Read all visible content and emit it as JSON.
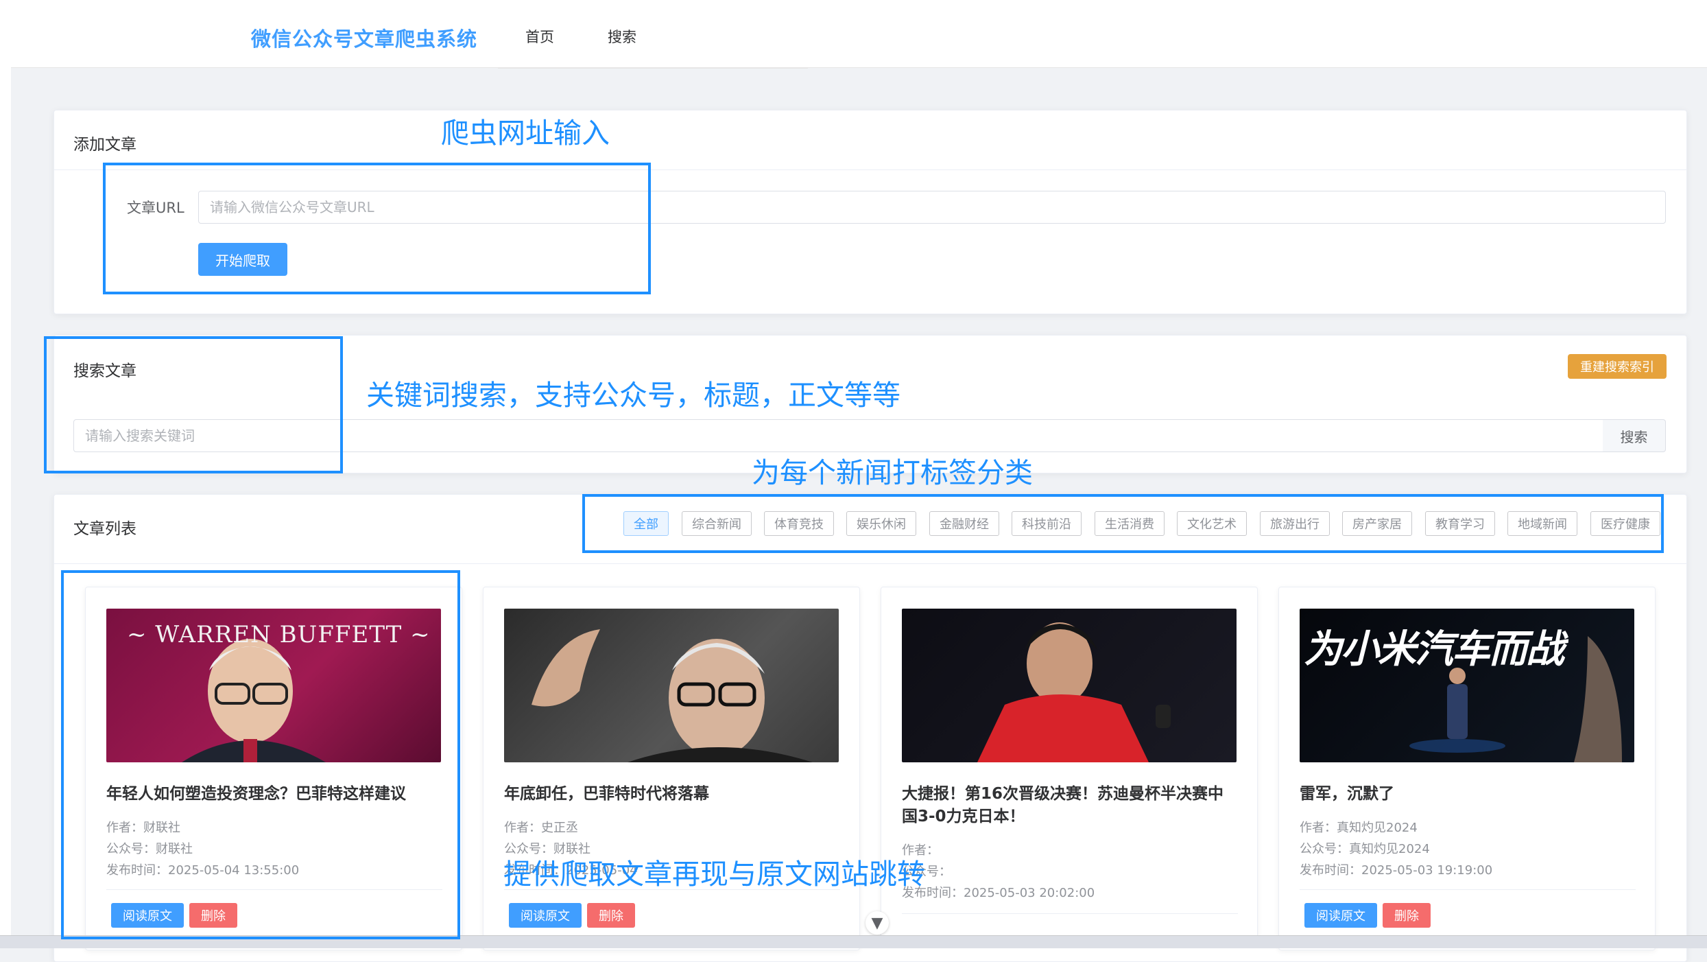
{
  "app": {
    "title": "微信公众号文章爬虫系统",
    "nav": [
      {
        "label": "首页"
      },
      {
        "label": "搜索"
      }
    ]
  },
  "add_card": {
    "title": "添加文章",
    "url_label": "文章URL",
    "url_placeholder": "请输入微信公众号文章URL",
    "submit_label": "开始爬取"
  },
  "search_card": {
    "title": "搜索文章",
    "rebuild_label": "重建搜索索引",
    "placeholder": "请输入搜索关键词",
    "search_label": "搜索"
  },
  "list_card": {
    "title": "文章列表",
    "categories": [
      "全部",
      "综合新闻",
      "体育竞技",
      "娱乐休闲",
      "金融财经",
      "科技前沿",
      "生活消费",
      "文化艺术",
      "旅游出行",
      "房产家居",
      "教育学习",
      "地域新闻",
      "医疗健康"
    ],
    "active_category": "全部"
  },
  "articles": [
    {
      "title": "年轻人如何塑造投资理念？巴菲特这样建议",
      "author": "作者：财联社",
      "account": "公众号：财联社",
      "time": "发布时间：2025-05-04 13:55:00",
      "read_label": "阅读原文",
      "delete_label": "删除",
      "image_text": "~ WARREN BUFFETT ~"
    },
    {
      "title": "年底卸任，巴菲特时代将落幕",
      "author": "作者：史正丞",
      "account": "公众号：财联社",
      "time": "发布时间：2025-05-04",
      "read_label": "阅读原文",
      "delete_label": "删除"
    },
    {
      "title": "大捷报！第16次晋级决赛！苏迪曼杯半决赛中国3-0力克日本！",
      "author": "作者：",
      "account": "公众号：",
      "time": "发布时间：2025-05-03 20:02:00",
      "read_label": "阅读原文",
      "delete_label": "删除"
    },
    {
      "title": "雷军，沉默了",
      "author": "作者：真知灼见2024",
      "account": "公众号：真知灼见2024",
      "time": "发布时间：2025-05-03 19:19:00",
      "read_label": "阅读原文",
      "delete_label": "删除",
      "image_text": "为小米汽车而战"
    }
  ],
  "annotations": {
    "url_input": "爬虫网址输入",
    "keyword_search": "关键词搜索，支持公众号，标题，正文等等",
    "tagging": "为每个新闻打标签分类",
    "reproduce": "提供爬取文章再现与原文网站跳转"
  },
  "colors": {
    "primary": "#409eff",
    "warning": "#e6a23c",
    "danger": "#f56c6c",
    "annotation": "#1e90ff"
  },
  "icons": {
    "scroll": "chevron-down-icon"
  }
}
